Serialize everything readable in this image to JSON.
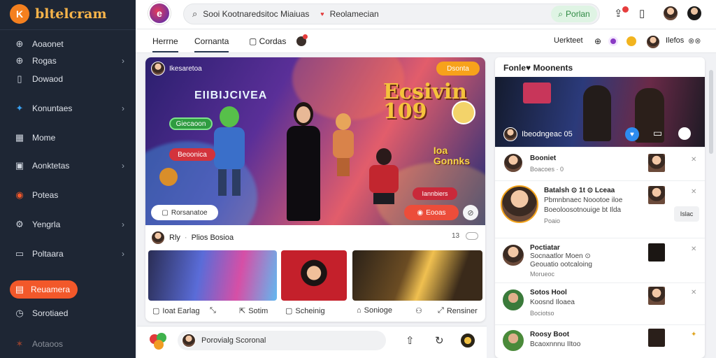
{
  "sidebar": {
    "logo_mark": "K",
    "logo_text": "bltelcram",
    "items": [
      {
        "icon": "globe-icon",
        "glyph": "⊕",
        "label": "Aoaonet"
      },
      {
        "icon": "globe-icon",
        "glyph": "⊕",
        "label": "Rogas",
        "chevron": "›"
      },
      {
        "icon": "bookmark-icon",
        "glyph": "▯",
        "label": "Dowaod"
      },
      {
        "icon": "twitter-icon",
        "glyph": "✦",
        "label": "Konuntaes",
        "chevron": "›"
      },
      {
        "icon": "grid-icon",
        "glyph": "▦",
        "label": "Mome"
      },
      {
        "icon": "image-icon",
        "glyph": "▣",
        "label": "Aonktetas",
        "chevron": "›"
      },
      {
        "icon": "record-icon",
        "glyph": "◉",
        "label": "Poteas"
      },
      {
        "icon": "settings-icon",
        "glyph": "⚙",
        "label": "Yengrla",
        "chevron": "›"
      },
      {
        "icon": "window-icon",
        "glyph": "▭",
        "label": "Poltaara",
        "chevron": "›"
      },
      {
        "icon": "calendar-icon",
        "glyph": "▤",
        "label": "Reuamera",
        "active": true
      },
      {
        "icon": "clock-icon",
        "glyph": "◷",
        "label": "Sorotiaed"
      },
      {
        "icon": "star-icon",
        "glyph": "✶",
        "label": "Aotaoos"
      }
    ]
  },
  "topbar": {
    "app_icon": "e",
    "search_value": "Sooi Kootnaredsitoc Miaiuas",
    "search_secondary": "Reolamecian",
    "search_button": "Porlan"
  },
  "subbar": {
    "tabs": [
      "Herrne",
      "Cornanta",
      "Cordas"
    ],
    "right_label": "Uerkteet"
  },
  "right_extra": "Ilefos",
  "hero": {
    "user": "Ikesaretoa",
    "live": "Dsonta",
    "title": "EIIBIJCIVEA",
    "green_tag": "Giecaoon",
    "red_tag": "Beoonica",
    "big_text": "Ecsivin\n109",
    "sub_text": "Ioa\nGonnks",
    "badge": "Iannbiers",
    "foot_left": "Rorsanatoe",
    "foot_right": "Eooas"
  },
  "post": {
    "user": "Rly",
    "title": "Plios Bosioa",
    "count": "13",
    "actions": [
      "Ioat Earlag",
      "Sotim",
      "Scheinig",
      "Sonioge",
      "Rensiner"
    ]
  },
  "compose": {
    "placeholder": "Porovialg Scoronal"
  },
  "rightpane": {
    "title": "Fonle♥  Moonents",
    "video_caption": "Ibeodngeac  05",
    "rows": [
      {
        "name": "Booniet",
        "line": "Boacoes",
        "meta": "0"
      },
      {
        "name": "Batalsh ⊙ 1t ⊙ Lceaa",
        "line": "Pbmnbnaec Noootoe iloe",
        "line2": "Boeoloosotnouige bt Ilda",
        "meta": "Poaio"
      },
      {
        "name": "Poctiatar",
        "line": "Socnaatlor Moen ⊙",
        "line2": "Geouatio ootcaloing",
        "meta": "Morueoc"
      },
      {
        "name": "Sotos Hool",
        "line": "Koosnd Iloaea",
        "meta": "Bociotso"
      },
      {
        "name": "Roosy Boot",
        "line": "Bcaoxnnnu IItoo",
        "meta": ""
      }
    ],
    "side_button": "Islac"
  }
}
